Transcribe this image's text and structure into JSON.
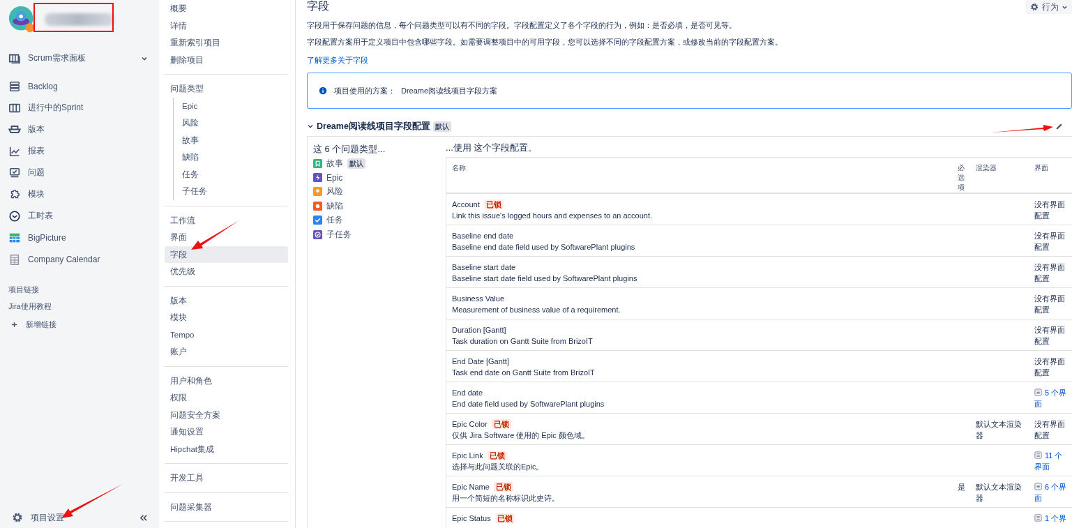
{
  "sidebar": {
    "board": {
      "label": "Scrum需求面板",
      "expanded": false
    },
    "items": [
      {
        "label": "Backlog"
      },
      {
        "label": "进行中的Sprint"
      },
      {
        "label": "版本"
      },
      {
        "label": "报表"
      },
      {
        "label": "问题"
      },
      {
        "label": "模块"
      },
      {
        "label": "工时表"
      },
      {
        "label": "BigPicture"
      },
      {
        "label": "Company Calendar"
      }
    ],
    "links_heading": "项目链接",
    "links": [
      "Jira使用教程"
    ],
    "add_link": "新增链接",
    "settings": "项目设置"
  },
  "settings_nav": {
    "groups": [
      [
        {
          "label": "概要",
          "selected": false
        },
        {
          "label": "详情",
          "selected": false
        },
        {
          "label": "重新索引项目",
          "selected": false
        },
        {
          "label": "删除项目",
          "selected": false
        }
      ],
      [
        {
          "label": "问题类型",
          "selected": false,
          "children": [
            {
              "label": "Epic",
              "selected": false
            },
            {
              "label": "风险",
              "selected": false
            },
            {
              "label": "故事",
              "selected": false
            },
            {
              "label": "缺陷",
              "selected": false
            },
            {
              "label": "任务",
              "selected": false
            },
            {
              "label": "子任务",
              "selected": false
            }
          ]
        }
      ],
      [
        {
          "label": "工作流",
          "selected": false
        },
        {
          "label": "界面",
          "selected": false
        },
        {
          "label": "字段",
          "selected": true
        },
        {
          "label": "优先级",
          "selected": false
        }
      ],
      [
        {
          "label": "版本",
          "selected": false
        },
        {
          "label": "模块",
          "selected": false
        },
        {
          "label": "Tempo",
          "selected": false
        },
        {
          "label": "账户",
          "selected": false
        }
      ],
      [
        {
          "label": "用户和角色",
          "selected": false
        },
        {
          "label": "权限",
          "selected": false
        },
        {
          "label": "问题安全方案",
          "selected": false
        },
        {
          "label": "通知设置",
          "selected": false
        },
        {
          "label": "Hipchat集成",
          "selected": false
        }
      ],
      [
        {
          "label": "开发工具",
          "selected": false
        }
      ],
      [
        {
          "label": "问题采集器",
          "selected": false
        }
      ]
    ]
  },
  "main": {
    "title": "字段",
    "actions_button": "行为",
    "descriptions": [
      "字段用于保存问题的信息，每个问题类型可以有不同的字段。字段配置定义了各个字段的行为，例如：是否必填，是否可见等。",
      "字段配置方案用于定义项目中包含哪些字段。如需要调整项目中的可用字段，您可以选择不同的字段配置方案，或修改当前的字段配置方案。"
    ],
    "learn_more": "了解更多关于字段",
    "scheme": {
      "label": "项目使用的方案：",
      "value": "Dreame阅读线项目字段方案"
    },
    "config": {
      "title": "Dreame阅读线项目字段配置",
      "badge": "默认",
      "expanded": true
    },
    "issue_types_heading": "这 6 个问题类型...",
    "issue_types": [
      {
        "label": "故事",
        "color": "#36b37e",
        "badge": "默认"
      },
      {
        "label": "Epic",
        "color": "#6554c0"
      },
      {
        "label": "风险",
        "color": "#ff991f"
      },
      {
        "label": "缺陷",
        "color": "#ff5630"
      },
      {
        "label": "任务",
        "color": "#2684ff"
      },
      {
        "label": "子任务",
        "color": "#6554c0"
      }
    ],
    "uses_heading": "...使用 这个字段配置。",
    "table": {
      "columns": [
        "名称",
        "必选项",
        "渲染器",
        "界面"
      ],
      "rows": [
        {
          "name": "Account",
          "locked": "已锁",
          "description": "Link this issue's logged hours and expenses to an account.",
          "screens": "没有界面配置",
          "kind": "text"
        },
        {
          "name": "Baseline end date",
          "description": "Baseline end date field used by SoftwarePlant plugins",
          "screens": "没有界面配置",
          "kind": "text"
        },
        {
          "name": "Baseline start date",
          "description": "Baseline start date field used by SoftwarePlant plugins",
          "screens": "没有界面配置",
          "kind": "text"
        },
        {
          "name": "Business Value",
          "description": "Measurement of business value of a requirement.",
          "screens": "没有界面配置",
          "kind": "text"
        },
        {
          "name": "Duration [Gantt]",
          "description": "Task duration on Gantt Suite from BrizoIT",
          "screens": "没有界面配置",
          "kind": "text"
        },
        {
          "name": "End Date [Gantt]",
          "description": "Task end date on Gantt Suite from BrizoIT",
          "screens": "没有界面配置",
          "kind": "text"
        },
        {
          "name": "End date",
          "description": "End date field used by SoftwarePlant plugins",
          "screens": "5 个界面",
          "kind": "link"
        },
        {
          "name": "Epic Color",
          "locked": "已锁",
          "description": "仅供 Jira Software 使用的 Epic 颜色域。",
          "renderer": "默认文本渲染器",
          "screens": "没有界面配置",
          "kind": "text"
        },
        {
          "name": "Epic Link",
          "locked": "已锁",
          "description": "选择与此问题关联的Epic。",
          "screens": "11 个界面",
          "kind": "link"
        },
        {
          "name": "Epic Name",
          "locked": "已锁",
          "description": "用一个简短的名称标识此史诗。",
          "required": "是",
          "renderer": "默认文本渲染器",
          "screens": "6 个界面",
          "kind": "link"
        },
        {
          "name": "Epic Status",
          "locked": "已锁",
          "screens": "1 个界",
          "kind": "link"
        }
      ]
    }
  }
}
